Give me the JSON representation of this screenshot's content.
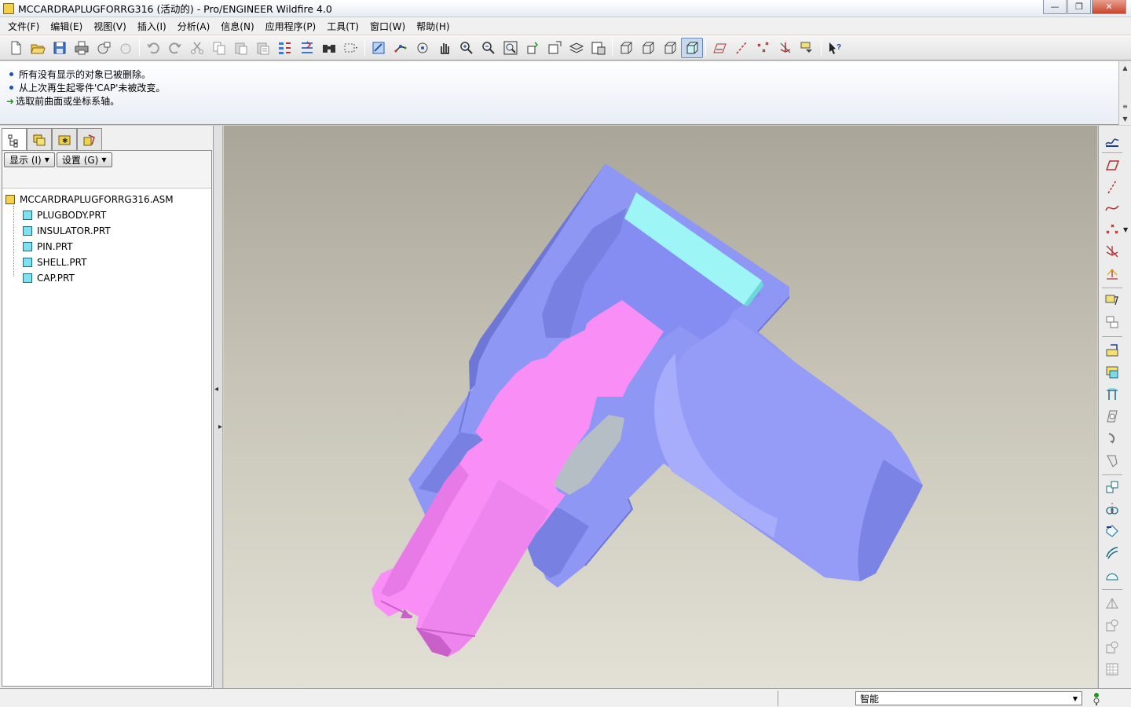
{
  "window": {
    "title": "MCCARDRAPLUGFORRG316 (活动的) - Pro/ENGINEER Wildfire 4.0",
    "minimize_glyph": "—",
    "maximize_glyph": "❐",
    "close_glyph": "✕"
  },
  "menu": {
    "items": [
      "文件(F)",
      "编辑(E)",
      "视图(V)",
      "插入(I)",
      "分析(A)",
      "信息(N)",
      "应用程序(P)",
      "工具(T)",
      "窗口(W)",
      "帮助(H)"
    ]
  },
  "messages": [
    "所有没有显示的对象已被删除。",
    "从上次再生起零件'CAP'未被改变。",
    "选取前曲面或坐标系轴。"
  ],
  "model_tree": {
    "show_button": "显示 (I)",
    "settings_button": "设置 (G)",
    "root": "MCCARDRAPLUGFORRG316.ASM",
    "parts": [
      "PLUGBODY.PRT",
      "INSULATOR.PRT",
      "PIN.PRT",
      "SHELL.PRT",
      "CAP.PRT"
    ]
  },
  "status": {
    "filter_value": "智能"
  },
  "colors": {
    "body_blue": "#8f97f5",
    "pin_pink": "#f98ef7",
    "insulator_gray": "#b5bdc5",
    "cap_cyan": "#9ef5f5",
    "background_top": "#a9a699",
    "background_bottom": "#e3e1d6"
  },
  "icons": {
    "toolbar": [
      "new-icon",
      "open-icon",
      "save-icon",
      "print-icon",
      "email-icon",
      "email-link-icon",
      "undo-icon",
      "redo-icon",
      "cut-icon",
      "copy-icon",
      "paste-icon",
      "paste-special-icon",
      "regenerate-icon",
      "regen-manager-icon",
      "find-icon",
      "select-box-icon",
      "repaint-icon",
      "spin-center-icon",
      "orient-icon",
      "pan-icon",
      "zoom-in-icon",
      "zoom-out-icon",
      "refit-icon",
      "reorient-icon",
      "saved-views-icon",
      "layers-icon",
      "view-manager-icon",
      "wireframe-icon",
      "hidden-line-icon",
      "no-hidden-icon",
      "shading-icon",
      "datum-planes-icon",
      "datum-axes-icon",
      "datum-points-icon",
      "coordinate-systems-icon",
      "annotations-icon",
      "whats-this-icon"
    ],
    "right_toolbar": [
      "sketch-icon",
      "datum-plane-icon",
      "datum-axis-icon",
      "datum-curve-icon",
      "datum-point-icon",
      "datum-csys-icon",
      "analysis-icon",
      "component-place-icon",
      "component-create-icon",
      "assembly-feature-icon",
      "extrude-icon",
      "revolve-icon",
      "hole-icon",
      "pattern-icon",
      "mirror-icon",
      "move-icon",
      "style-icon",
      "boundary-icon",
      "merge-icon",
      "trim-icon",
      "offset-icon",
      "table-icon"
    ]
  }
}
